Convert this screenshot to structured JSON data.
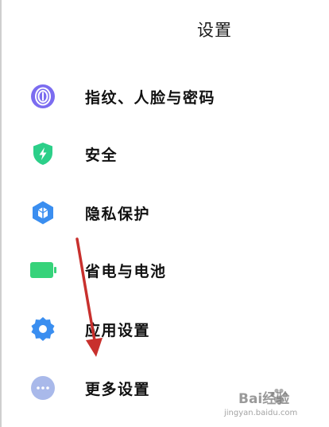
{
  "header": {
    "title": "设置"
  },
  "settings_items": [
    {
      "label": "指纹、人脸与密码",
      "icon": "fingerprint-icon",
      "color": "#7b6cf0"
    },
    {
      "label": "安全",
      "icon": "shield-bolt-icon",
      "color": "#2ccf89"
    },
    {
      "label": "隐私保护",
      "icon": "privacy-cube-icon",
      "color": "#3a8ef0"
    },
    {
      "label": "省电与电池",
      "icon": "battery-icon",
      "color": "#36d37a"
    },
    {
      "label": "应用设置",
      "icon": "gear-icon",
      "color": "#3a8ef0"
    },
    {
      "label": "更多设置",
      "icon": "more-dots-icon",
      "color": "#a9b9ea"
    }
  ],
  "annotation": {
    "arrow_color": "#c8302d"
  },
  "watermark": {
    "main": "Bai经验",
    "sub": "jingyan.baidu.com"
  }
}
